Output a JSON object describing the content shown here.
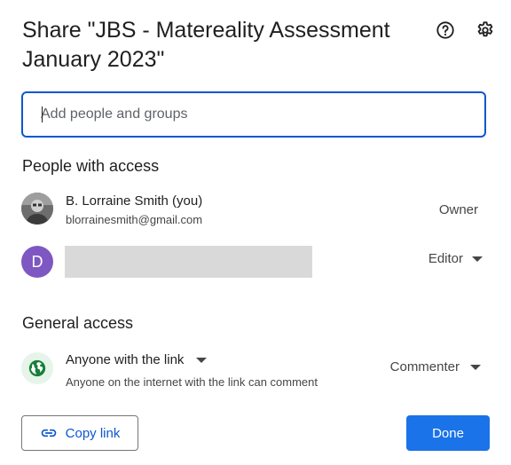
{
  "dialog": {
    "title": "Share \"JBS - Matereality Assessment January 2023\"",
    "help_icon": "help-circle-icon",
    "settings_icon": "gear-icon"
  },
  "add_people": {
    "placeholder": "Add people and groups",
    "value": ""
  },
  "people_section": {
    "title": "People with access",
    "people": [
      {
        "name": "B. Lorraine Smith (you)",
        "email": "blorrainesmith@gmail.com",
        "role": "Owner",
        "avatar": "photo"
      },
      {
        "initial": "D",
        "role": "Editor",
        "avatar_color": "#7e57c2"
      }
    ]
  },
  "general_access": {
    "title": "General access",
    "option": "Anyone with the link",
    "description": "Anyone on the internet with the link can comment",
    "role": "Commenter",
    "icon": "globe-icon"
  },
  "footer": {
    "copy_link_label": "Copy link",
    "done_label": "Done"
  },
  "colors": {
    "accent": "#0b57d0",
    "done_button": "#1a73e8",
    "globe_bg": "#e6f4ea",
    "globe": "#188038"
  }
}
